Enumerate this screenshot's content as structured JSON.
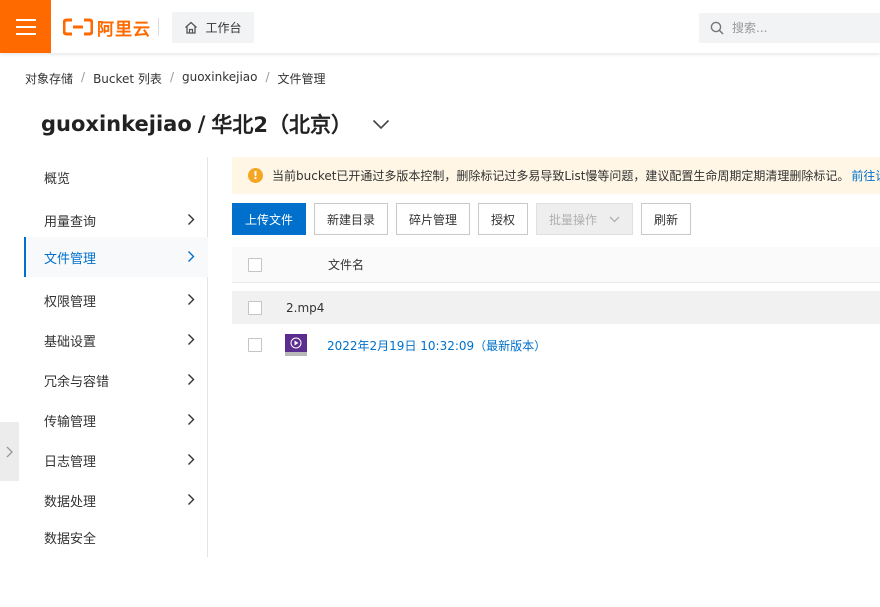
{
  "header": {
    "logo_text": "阿里云",
    "workbench_label": "工作台",
    "search_placeholder": "搜索..."
  },
  "breadcrumb": [
    "对象存储",
    "Bucket 列表",
    "guoxinkejiao",
    "文件管理"
  ],
  "title": {
    "bucket": "guoxinkejiao",
    "separator": "/",
    "region": "华北2（北京）"
  },
  "sidebar": {
    "items": [
      {
        "label": "概览",
        "chevron": false
      },
      {
        "label": "用量查询",
        "chevron": true
      },
      {
        "label": "文件管理",
        "chevron": true,
        "active": true
      },
      {
        "label": "权限管理",
        "chevron": true
      },
      {
        "label": "基础设置",
        "chevron": true
      },
      {
        "label": "冗余与容错",
        "chevron": true
      },
      {
        "label": "传输管理",
        "chevron": true
      },
      {
        "label": "日志管理",
        "chevron": true
      },
      {
        "label": "数据处理",
        "chevron": true
      },
      {
        "label": "数据安全",
        "chevron": false
      }
    ]
  },
  "notice": {
    "text": "当前bucket已开通过多版本控制，删除标记过多易导致List慢等问题，建议配置生命周期定期清理删除标记。",
    "link": "前往设置"
  },
  "toolbar": {
    "upload": "上传文件",
    "new_dir": "新建目录",
    "fragments": "碎片管理",
    "authorize": "授权",
    "batch": "批量操作",
    "refresh": "刷新"
  },
  "table": {
    "column_name": "文件名",
    "rows": [
      {
        "name": "2.mp4"
      },
      {
        "version": "2022年2月19日 10:32:09（最新版本）"
      }
    ]
  },
  "colors": {
    "brand": "#ff6a00",
    "primary": "#0070cc",
    "notice_bg": "#fff6e5"
  }
}
